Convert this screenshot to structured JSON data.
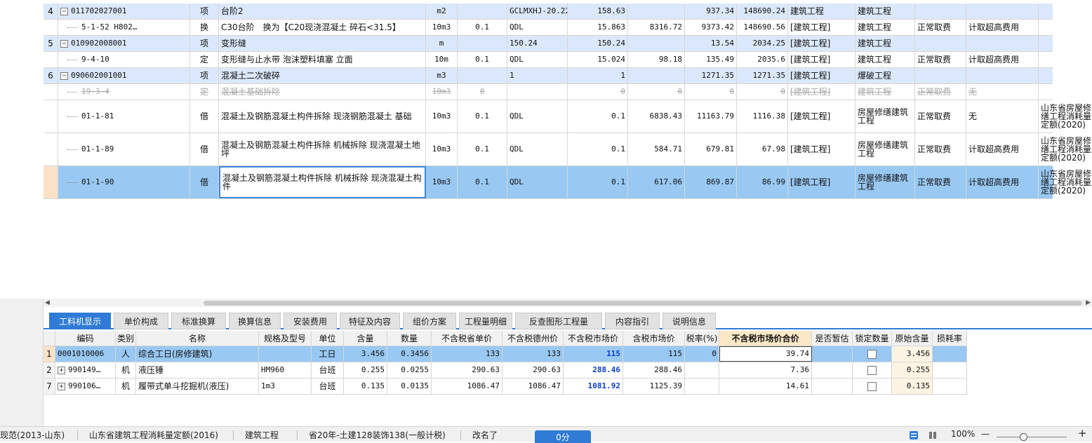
{
  "top_rows": [
    {
      "kind": "qd",
      "no": "4",
      "code": "011702027001",
      "type": "项",
      "name": "台阶2",
      "unit": "m2",
      "qty": "",
      "expr": "GCLMXHJ-20.22",
      "amount": "158.63",
      "price": "",
      "unit_price": "937.34",
      "total": "148690.24",
      "major": "建筑工程",
      "exec": "建筑工程",
      "fee": "",
      "ceiling": "",
      "remark": ""
    },
    {
      "kind": "de",
      "no": "",
      "code": "5-1-52 H802…",
      "type": "换",
      "name": "C30台阶　换为【C20现浇混凝土 碎石<31.5】",
      "unit": "10m3",
      "qty": "0.1",
      "expr": "QDL",
      "amount": "15.863",
      "price": "8316.72",
      "unit_price": "9373.42",
      "total": "148690.56",
      "major": "[建筑工程]",
      "exec": "建筑工程",
      "fee": "正常取费",
      "ceiling": "计取超高费用",
      "remark": ""
    },
    {
      "kind": "qd",
      "no": "5",
      "code": "010902008001",
      "type": "项",
      "name": "变形缝",
      "unit": "m",
      "qty": "",
      "expr": "150.24",
      "amount": "150.24",
      "price": "",
      "unit_price": "13.54",
      "total": "2034.25",
      "major": "[建筑工程]",
      "exec": "建筑工程",
      "fee": "",
      "ceiling": "",
      "remark": ""
    },
    {
      "kind": "de",
      "no": "",
      "code": "9-4-10",
      "type": "定",
      "name": "变形缝与止水带 泡沫塑料填塞 立面",
      "unit": "10m",
      "qty": "0.1",
      "expr": "QDL",
      "amount": "15.024",
      "price": "98.18",
      "unit_price": "135.49",
      "total": "2035.6",
      "major": "[建筑工程]",
      "exec": "建筑工程",
      "fee": "正常取费",
      "ceiling": "计取超高费用",
      "remark": ""
    },
    {
      "kind": "qd",
      "no": "6",
      "code": "090602001001",
      "type": "项",
      "name": "混凝土二次破碎",
      "unit": "m3",
      "qty": "",
      "expr": "1",
      "amount": "1",
      "price": "",
      "unit_price": "1271.35",
      "total": "1271.35",
      "major": "[建筑工程]",
      "exec": "爆破工程",
      "fee": "",
      "ceiling": "",
      "remark": ""
    },
    {
      "kind": "del",
      "no": "",
      "code": "19-3-4",
      "type": "定",
      "name": "混凝土基础拆除",
      "unit": "10m3",
      "qty": "0",
      "expr": "",
      "amount": "0",
      "price": "0",
      "unit_price": "0",
      "total": "0",
      "major": "[建筑工程]",
      "exec": "建筑工程",
      "fee": "正常取费",
      "ceiling": "无",
      "remark": ""
    },
    {
      "kind": "de",
      "no": "",
      "code": "01-1-81",
      "type": "借",
      "name": "混凝土及钢筋混凝土构件拆除 现浇钢筋混凝土 基础",
      "unit": "10m3",
      "qty": "0.1",
      "expr": "QDL",
      "amount": "0.1",
      "price": "6838.43",
      "unit_price": "11163.79",
      "total": "1116.38",
      "major": "[建筑工程]",
      "exec": "房屋修缮建筑工程",
      "fee": "正常取费",
      "ceiling": "无",
      "remark": "山东省房屋修缮工程消耗量定额(2020)"
    },
    {
      "kind": "de",
      "no": "",
      "code": "01-1-89",
      "type": "借",
      "name": "混凝土及钢筋混凝土构件拆除 机械拆除 现浇混凝土地坪",
      "unit": "10m3",
      "qty": "0.1",
      "expr": "QDL",
      "amount": "0.1",
      "price": "584.71",
      "unit_price": "679.81",
      "total": "67.98",
      "major": "[建筑工程]",
      "exec": "房屋修缮建筑工程",
      "fee": "正常取费",
      "ceiling": "计取超高费用",
      "remark": "山东省房屋修缮工程消耗量定额(2020)"
    },
    {
      "kind": "sel",
      "no": "",
      "code": "01-1-90",
      "type": "借",
      "name": "混凝土及钢筋混凝土构件拆除 机械拆除 现浇混凝土构件",
      "unit": "10m3",
      "qty": "0.1",
      "expr": "QDL",
      "amount": "0.1",
      "price": "617.06",
      "unit_price": "869.87",
      "total": "86.99",
      "major": "[建筑工程]",
      "exec": "房屋修缮建筑工程",
      "fee": "正常取费",
      "ceiling": "计取超高费用",
      "remark": "山东省房屋修缮工程消耗量定额(2020)"
    }
  ],
  "tabs": [
    "工料机显示",
    "单价构成",
    "标准换算",
    "换算信息",
    "安装费用",
    "特征及内容",
    "组价方案",
    "工程量明细",
    "反查图形工程量",
    "内容指引",
    "说明信息"
  ],
  "sub_headers": [
    "",
    "编码",
    "类别",
    "名称",
    "规格及型号",
    "单位",
    "含量",
    "数量",
    "不含税省单价",
    "不含税德州价",
    "不含税市场价",
    "含税市场价",
    "税率(%)",
    "不含税市场价合价",
    "是否暂估",
    "锁定数量",
    "原始含量",
    "损耗率"
  ],
  "sub_rows": [
    {
      "rn": "1",
      "expand": "",
      "code": "0001010006",
      "cat": "人",
      "name": "综合工日(房修建筑)",
      "spec": "",
      "unit": "工日",
      "content": "3.456",
      "qty": "0.3456",
      "prov": "133",
      "dz": "133",
      "market": "115",
      "market_tax": "115",
      "tax": "0",
      "sum": "39.74",
      "est": "",
      "orig": "3.456",
      "loss": ""
    },
    {
      "rn": "2",
      "expand": "+",
      "code": "990149…",
      "cat": "机",
      "name": "液压锤",
      "spec": "HM960",
      "unit": "台班",
      "content": "0.255",
      "qty": "0.0255",
      "prov": "290.63",
      "dz": "290.63",
      "market": "288.46",
      "market_tax": "288.46",
      "tax": "",
      "sum": "7.36",
      "est": "",
      "orig": "0.255",
      "loss": ""
    },
    {
      "rn": "7",
      "expand": "+",
      "code": "990106…",
      "cat": "机",
      "name": "履带式单斗挖掘机(液压)",
      "spec": "1m3",
      "unit": "台班",
      "content": "0.135",
      "qty": "0.0135",
      "prov": "1086.47",
      "dz": "1086.47",
      "market": "1081.92",
      "market_tax": "1125.39",
      "tax": "",
      "sum": "14.61",
      "est": "",
      "orig": "0.135",
      "loss": ""
    }
  ],
  "status": {
    "item1": "现范(2013-山东)",
    "item2": "山东省建筑工程消耗量定额(2016)",
    "item3": "建筑工程",
    "item4": "省20年-土建128装饰138(一般计税)",
    "item5": "改名了",
    "score": "0分",
    "zoom": "100%",
    "minus": "—",
    "plus": "+"
  }
}
